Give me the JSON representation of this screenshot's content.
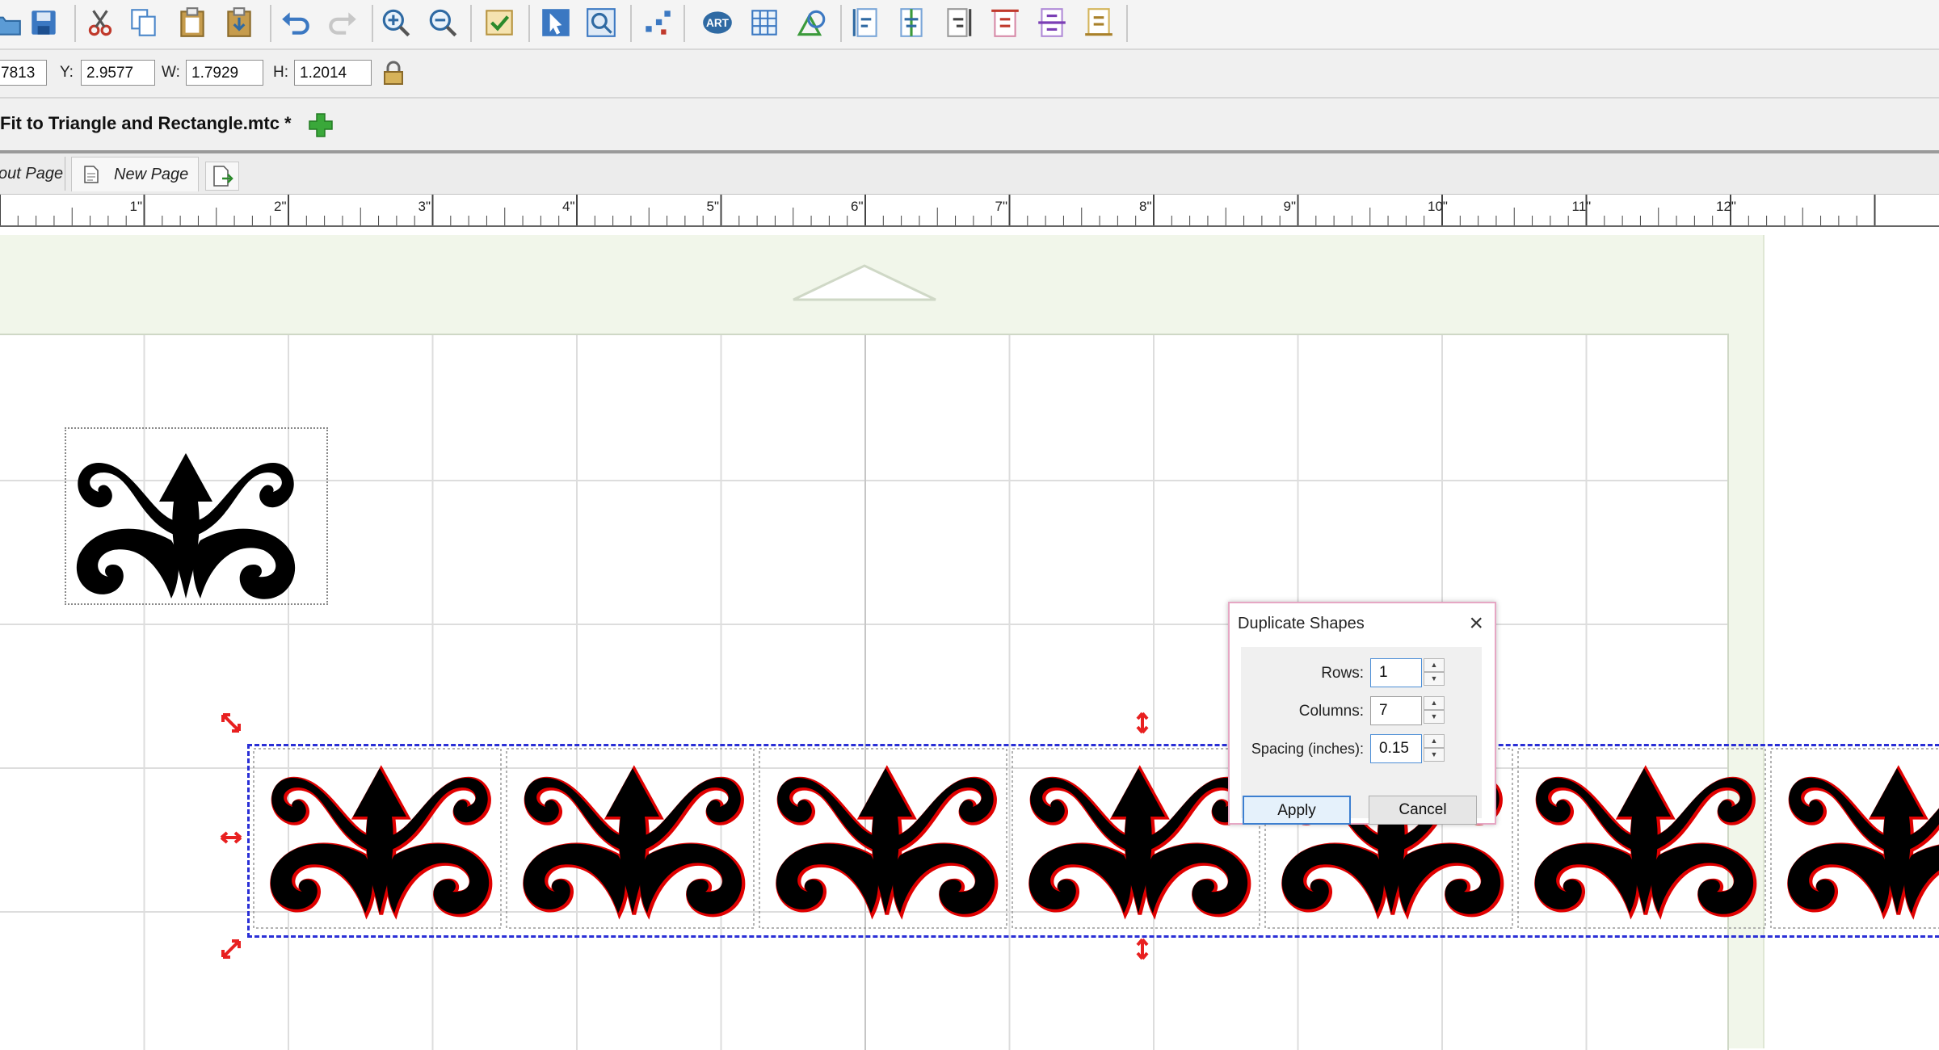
{
  "toolbar": {
    "icons": [
      "open-icon",
      "save-icon",
      "cut-icon",
      "copy-icon",
      "paste-icon",
      "paste-in-place-icon",
      "undo-icon",
      "redo-icon",
      "zoom-in-icon",
      "zoom-out-icon",
      "checkmark-icon",
      "select-tool-icon",
      "zoom-box-icon",
      "node-edit-icon",
      "art-library-icon",
      "grid-table-icon",
      "shapes-icon",
      "align-left-icon",
      "align-center-icon",
      "align-right-icon",
      "align-top-icon",
      "align-middle-icon",
      "align-bottom-icon"
    ]
  },
  "props": {
    "x_value": "7813",
    "y_label": "Y:",
    "y_value": "2.9577",
    "w_label": "W:",
    "w_value": "1.7929",
    "h_label": "H:",
    "h_value": "1.2014"
  },
  "document": {
    "tab_title": "Fit to Triangle and Rectangle.mtc *"
  },
  "pages": {
    "tabs": [
      "out Page",
      "New Page"
    ]
  },
  "ruler": {
    "labels": [
      "1\"",
      "2\"",
      "3\"",
      "4\"",
      "5\"",
      "6\"",
      "7\"",
      "8\"",
      "9\"",
      "10\"",
      "11\"",
      "12\""
    ]
  },
  "dialog": {
    "title": "Duplicate Shapes",
    "rows_label": "Rows:",
    "rows_value": "1",
    "columns_label": "Columns:",
    "columns_value": "7",
    "spacing_label": "Spacing (inches):",
    "spacing_value": "0.15",
    "apply_label": "Apply",
    "cancel_label": "Cancel"
  },
  "colors": {
    "selection": "#2a2fd6",
    "handle": "#e82020",
    "shape": "#000000",
    "outline": "#e00000",
    "mat": "#f1f6ea",
    "dialog_border": "#e6a7c4"
  }
}
